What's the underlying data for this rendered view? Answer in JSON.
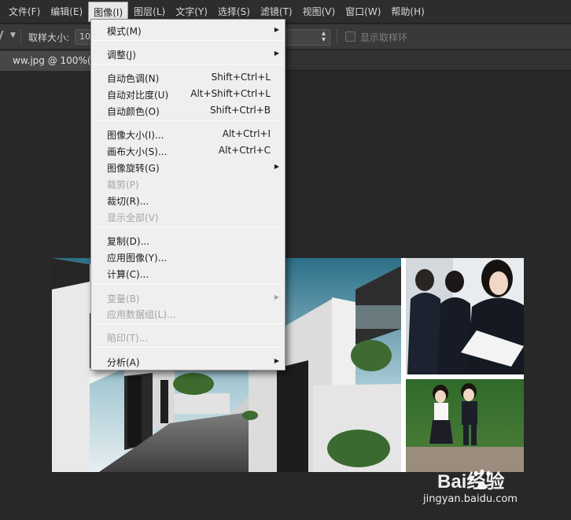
{
  "menubar": {
    "items": [
      {
        "label": "文件(F)"
      },
      {
        "label": "编辑(E)"
      },
      {
        "label": "图像(I)",
        "active": true
      },
      {
        "label": "图层(L)"
      },
      {
        "label": "文字(Y)"
      },
      {
        "label": "选择(S)"
      },
      {
        "label": "滤镜(T)"
      },
      {
        "label": "视图(V)"
      },
      {
        "label": "窗口(W)"
      },
      {
        "label": "帮助(H)"
      }
    ]
  },
  "options_bar": {
    "sample_size_label": "取样大小:",
    "sample_size_value": "10",
    "show_sampling_ring_label": "显示取样环",
    "show_sampling_ring_checked": false
  },
  "document": {
    "tab_title": "ww.jpg @ 100%(R"
  },
  "image_menu": {
    "items": [
      {
        "label": "模式(M)",
        "submenu": true
      },
      {
        "label": "调整(J)",
        "submenu": true
      },
      {
        "label": "自动色调(N)",
        "shortcut": "Shift+Ctrl+L"
      },
      {
        "label": "自动对比度(U)",
        "shortcut": "Alt+Shift+Ctrl+L"
      },
      {
        "label": "自动颜色(O)",
        "shortcut": "Shift+Ctrl+B"
      },
      {
        "label": "图像大小(I)...",
        "shortcut": "Alt+Ctrl+I"
      },
      {
        "label": "画布大小(S)...",
        "shortcut": "Alt+Ctrl+C"
      },
      {
        "label": "图像旋转(G)",
        "submenu": true
      },
      {
        "label": "裁剪(P)",
        "disabled": true
      },
      {
        "label": "裁切(R)..."
      },
      {
        "label": "显示全部(V)",
        "disabled": true
      },
      {
        "label": "复制(D)..."
      },
      {
        "label": "应用图像(Y)..."
      },
      {
        "label": "计算(C)..."
      },
      {
        "label": "变量(B)",
        "submenu": true,
        "disabled": true
      },
      {
        "label": "应用数据组(L)...",
        "disabled": true
      },
      {
        "label": "陷印(T)...",
        "disabled": true
      },
      {
        "label": "分析(A)",
        "submenu": true
      }
    ]
  },
  "watermark": {
    "brand": "Bai经验",
    "url": "jingyan.baidu.com"
  },
  "icons": {
    "submenu_arrow": "triangle-right-icon",
    "stepper": "up-down-arrows-icon",
    "paw": "baidu-paw-icon"
  }
}
